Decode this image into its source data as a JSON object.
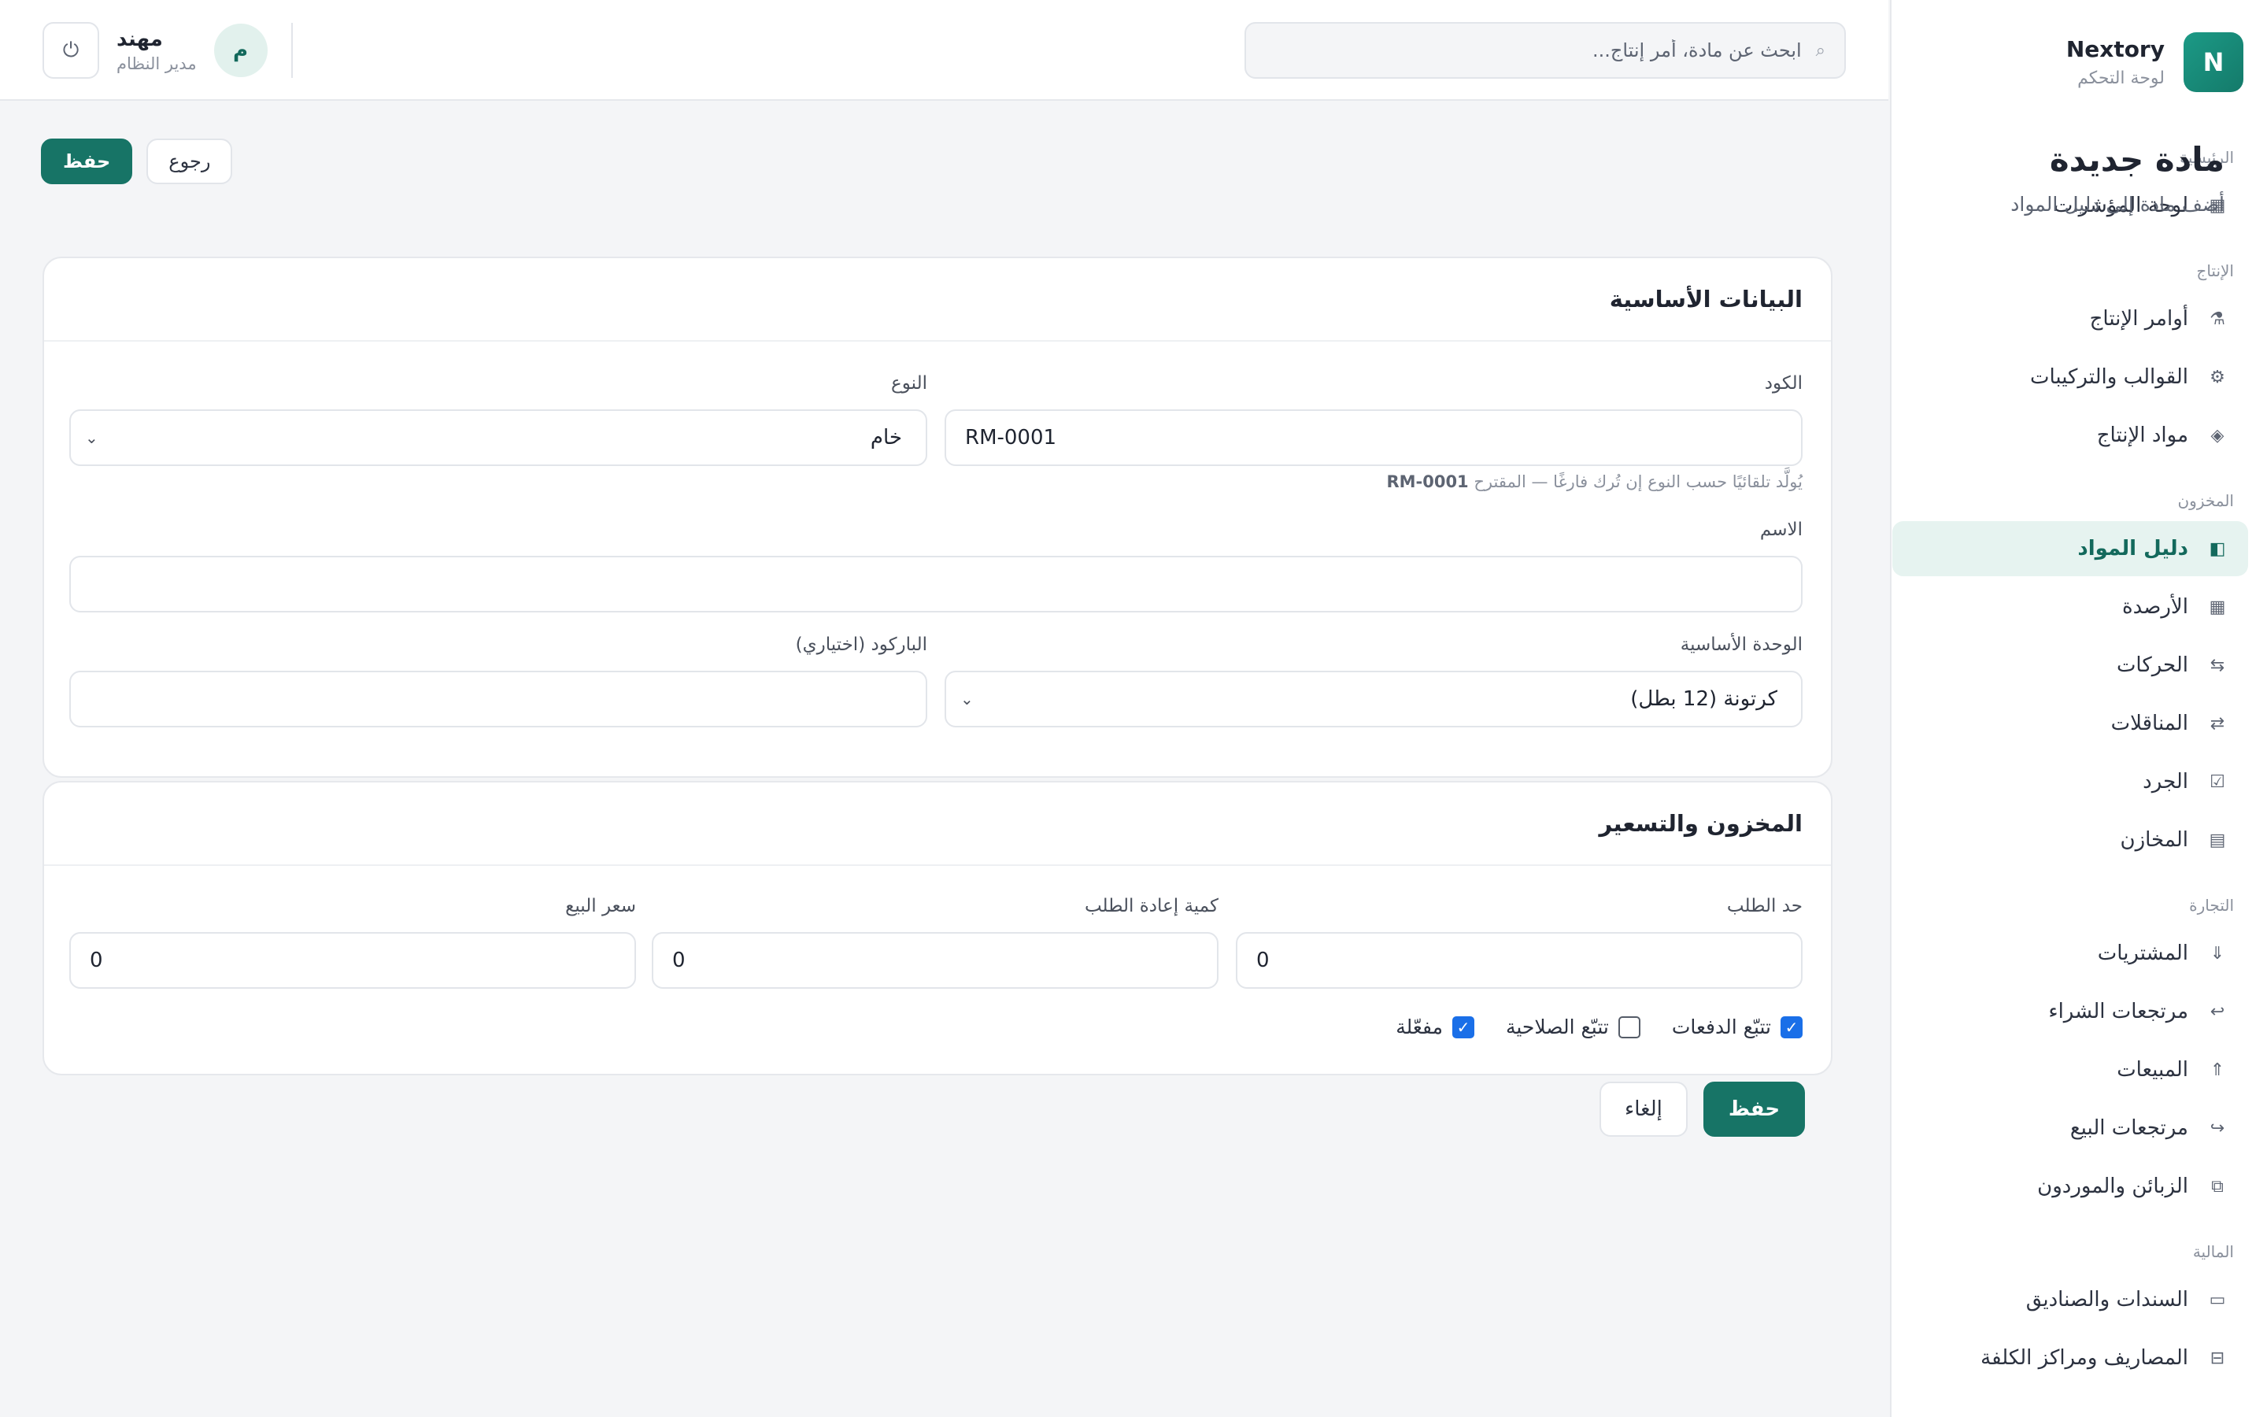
{
  "brand": {
    "name": "Nextory",
    "subtitle": "لوحة التحكم",
    "logo_letter": "N"
  },
  "sidebar": {
    "sections": [
      {
        "title": "الرئيسية",
        "items": [
          {
            "label": "لوحة المؤشرات",
            "icon": "dashboard-icon"
          }
        ]
      },
      {
        "title": "الإنتاج",
        "items": [
          {
            "label": "أوامر الإنتاج",
            "icon": "factory-icon"
          },
          {
            "label": "القوالب والتركيبات",
            "icon": "gear-icon"
          },
          {
            "label": "مواد الإنتاج",
            "icon": "diamond-icon"
          }
        ]
      },
      {
        "title": "المخزون",
        "items": [
          {
            "label": "دليل المواد",
            "icon": "catalog-icon",
            "active": true
          },
          {
            "label": "الأرصدة",
            "icon": "grid-icon"
          },
          {
            "label": "الحركات",
            "icon": "movements-icon"
          },
          {
            "label": "المناقلات",
            "icon": "transfer-icon"
          },
          {
            "label": "الجرد",
            "icon": "checklist-icon"
          },
          {
            "label": "المخازن",
            "icon": "warehouse-icon"
          }
        ]
      },
      {
        "title": "التجارة",
        "items": [
          {
            "label": "المشتريات",
            "icon": "arrow-down-icon"
          },
          {
            "label": "مرتجعات الشراء",
            "icon": "return-left-icon"
          },
          {
            "label": "المبيعات",
            "icon": "arrow-up-icon"
          },
          {
            "label": "مرتجعات البيع",
            "icon": "return-right-icon"
          },
          {
            "label": "الزبائن والموردون",
            "icon": "contacts-icon"
          }
        ]
      },
      {
        "title": "المالية",
        "items": [
          {
            "label": "السندات والصناديق",
            "icon": "cash-icon"
          },
          {
            "label": "المصاريف ومراكز الكلفة",
            "icon": "expenses-icon"
          }
        ]
      }
    ]
  },
  "topbar": {
    "search_placeholder": "ابحث عن مادة، أمر إنتاج...",
    "user": {
      "name": "مهند",
      "role": "مدير النظام",
      "initial": "م"
    }
  },
  "page": {
    "title": "مادة جديدة",
    "subtitle": "أضف مادة إلى دليل المواد",
    "back_label": "رجوع",
    "save_label": "حفظ"
  },
  "basic": {
    "title": "البيانات الأساسية",
    "code_label": "الكود",
    "code_value": "RM-0001",
    "code_hint": "يُولَّد تلقائيًا حسب النوع إن تُرك فارغًا — المقترح",
    "code_hint_value": "RM-0001",
    "type_label": "النوع",
    "type_value": "خام",
    "name_label": "الاسم",
    "name_value": "",
    "unit_label": "الوحدة الأساسية",
    "unit_value": "كرتونة (12 بطل)",
    "barcode_label": "الباركود (اختياري)",
    "barcode_value": ""
  },
  "stock": {
    "title": "المخزون والتسعير",
    "reorder_limit_label": "حد الطلب",
    "reorder_limit_value": "0",
    "reorder_qty_label": "كمية إعادة الطلب",
    "reorder_qty_value": "0",
    "sale_price_label": "سعر البيع",
    "sale_price_value": "0",
    "checkboxes": [
      {
        "label": "تتبّع الدفعات",
        "checked": true
      },
      {
        "label": "تتبّع الصلاحية",
        "checked": false
      },
      {
        "label": "مفعّلة",
        "checked": true
      }
    ]
  },
  "form_actions": {
    "save_label": "حفظ",
    "cancel_label": "إلغاء"
  },
  "colors": {
    "primary": "#177466",
    "active_bg": "#e6f3f0",
    "checkbox": "#1a6fe8"
  }
}
